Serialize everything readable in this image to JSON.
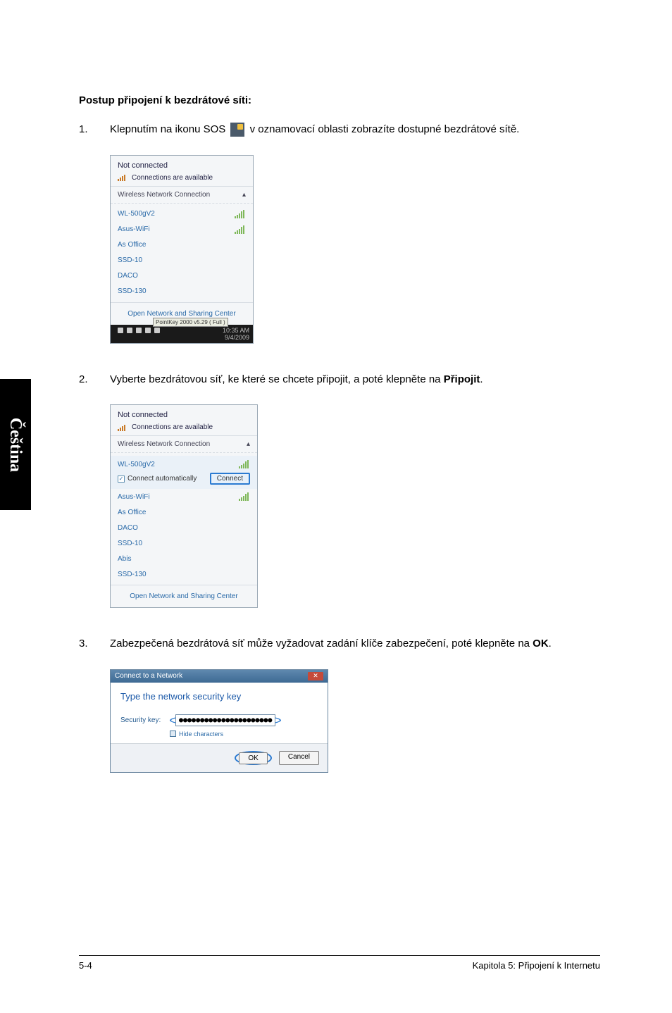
{
  "side_tab": "Čeština",
  "heading": "Postup připojení k bezdrátové síti:",
  "steps": {
    "s1": {
      "num": "1.",
      "t1": "Klepnutím na ikonu SOS ",
      "t2": " v oznamovací oblasti zobrazíte dostupné bezdrátové sítě."
    },
    "s2": {
      "num": "2.",
      "t1": "Vyberte bezdrátovou síť, ke které se chcete připojit, a poté klepněte na ",
      "b": "Připojit",
      "t2": "."
    },
    "s3": {
      "num": "3.",
      "t1": "Zabezpečená bezdrátová síť může vyžadovat zadání klíče zabezpečení, poté klepněte na ",
      "b": "OK",
      "t2": "."
    }
  },
  "shot1": {
    "not_connected": "Not connected",
    "avail": "Connections are available",
    "wnc": "Wireless Network Connection",
    "wnc_up": "▴",
    "items": [
      {
        "name": "WL-500gV2",
        "sig": "s5"
      },
      {
        "name": "Asus-WiFi",
        "sig": "s5"
      },
      {
        "name": "As Office",
        "sig": "s4"
      },
      {
        "name": "SSD-10",
        "sig": "s3"
      },
      {
        "name": "DACO",
        "sig": "s2"
      },
      {
        "name": "SSD-130",
        "sig": "s2"
      }
    ],
    "open_link": "Open Network and Sharing Center",
    "pk": "PointKey 2000 v5.29 ( Full )",
    "time": "10:35 AM",
    "date": "9/4/2009"
  },
  "shot2": {
    "not_connected": "Not connected",
    "avail": "Connections are available",
    "wnc": "Wireless Network Connection",
    "wnc_up": "▴",
    "sel_name": "WL-500gV2",
    "cb_label": "Connect automatically",
    "connect_btn": "Connect",
    "items": [
      {
        "name": "Asus-WiFi",
        "sig": "s5"
      },
      {
        "name": "As Office",
        "sig": "s4"
      },
      {
        "name": "DACO",
        "sig": "s3"
      },
      {
        "name": "SSD-10",
        "sig": "s2"
      },
      {
        "name": "Abis",
        "sig": "s1"
      },
      {
        "name": "SSD-130",
        "sig": "s1"
      }
    ],
    "open_link": "Open Network and Sharing Center"
  },
  "shot3": {
    "title": "Connect to a Network",
    "heading": "Type the network security key",
    "key_label": "Security key:",
    "key_value": "●●●●●●●●●●●●●●●●●●●●●●",
    "hide": "Hide characters",
    "ok": "OK",
    "cancel": "Cancel"
  },
  "footer": {
    "left": "5-4",
    "right": "Kapitola 5: Připojení k Internetu"
  }
}
